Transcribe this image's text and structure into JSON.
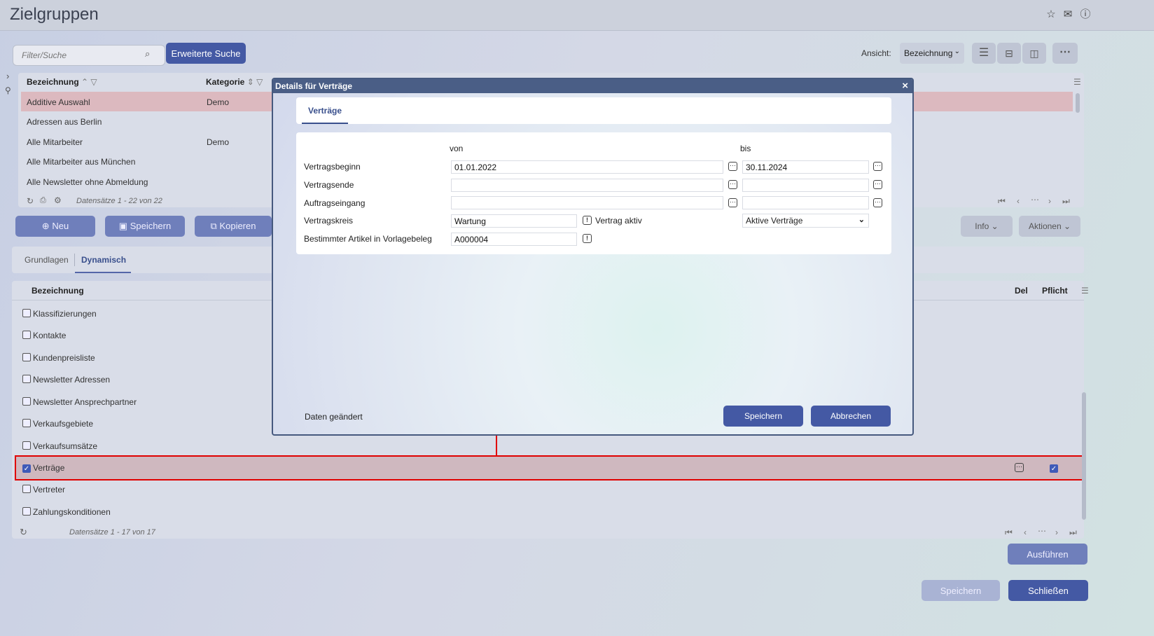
{
  "page": {
    "title": "Zielgruppen"
  },
  "toolbar": {
    "filter_placeholder": "Filter/Suche",
    "advanced_search_label": "Erweiterte Suche",
    "view_label": "Ansicht:",
    "view_selected": "Bezeichnung"
  },
  "top_table": {
    "columns": [
      "Bezeichnung",
      "Kategorie"
    ],
    "rows": [
      [
        "Additive Auswahl",
        "Demo"
      ],
      [
        "Adressen aus Berlin",
        ""
      ],
      [
        "Alle Mitarbeiter",
        "Demo"
      ],
      [
        "Alle Mitarbeiter aus München",
        ""
      ],
      [
        "Alle Newsletter ohne Abmeldung",
        ""
      ]
    ],
    "records": "Datensätze 1 - 22 von 22"
  },
  "actions": {
    "new": "Neu",
    "save": "Speichern",
    "copy": "Kopieren",
    "info": "Info",
    "actions": "Aktionen"
  },
  "detail_tabs": [
    "Grundlagen",
    "Dynamisch"
  ],
  "dynamic_table": {
    "col_name": "Bezeichnung",
    "col_del": "Del",
    "col_required": "Pflicht",
    "rows": [
      {
        "label": "Klassifizierungen",
        "checked": false
      },
      {
        "label": "Kontakte",
        "checked": false
      },
      {
        "label": "Kundenpreisliste",
        "checked": false
      },
      {
        "label": "Newsletter Adressen",
        "checked": false
      },
      {
        "label": "Newsletter Ansprechpartner",
        "checked": false
      },
      {
        "label": "Verkaufsgebiete",
        "checked": false
      },
      {
        "label": "Verkaufsumsätze",
        "checked": false
      },
      {
        "label": "Verträge",
        "checked": true
      },
      {
        "label": "Vertreter",
        "checked": false
      },
      {
        "label": "Zahlungskonditionen",
        "checked": false
      }
    ],
    "records": "Datensätze 1 - 17 von 17"
  },
  "footer": {
    "execute": "Ausführen",
    "save": "Speichern",
    "close": "Schließen"
  },
  "modal": {
    "title": "Details für Verträge",
    "tab": "Verträge",
    "col_from": "von",
    "col_to": "bis",
    "fields": {
      "start_label": "Vertragsbeginn",
      "start_from": "01.01.2022",
      "start_to": "30.11.2024",
      "end_label": "Vertragsende",
      "order_label": "Auftragseingang",
      "circle_label": "Vertragskreis",
      "circle_value": "Wartung",
      "active_label": "Vertrag aktiv",
      "active_select": "Aktive Verträge",
      "article_label": "Bestimmter Artikel in Vorlagebeleg",
      "article_value": "A000004"
    },
    "status": "Daten geändert",
    "save": "Speichern",
    "cancel": "Abbrechen"
  },
  "colors": {
    "primary": "#4459a4",
    "modal_header": "#4a5e86",
    "highlight": "#e00000"
  }
}
